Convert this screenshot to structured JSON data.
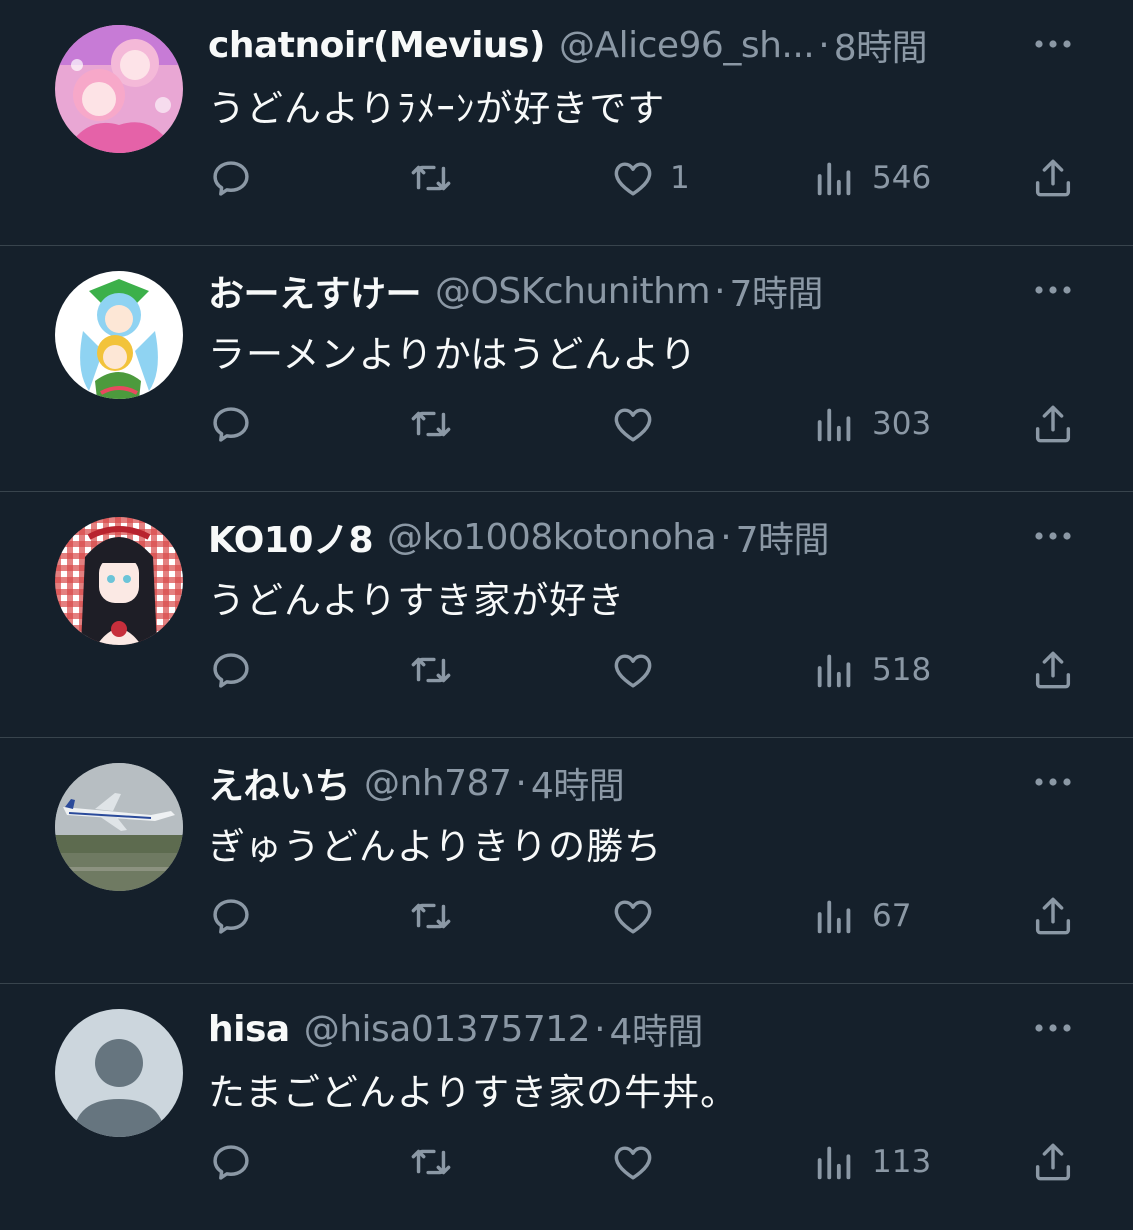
{
  "icons": {
    "reply": "reply-icon",
    "retweet": "retweet-icon",
    "like": "heart-icon",
    "views": "views-icon",
    "share": "share-icon",
    "more": "more-icon"
  },
  "colors": {
    "background": "#15202b",
    "divider": "#38444d",
    "primary_text": "#f7f9f9",
    "secondary_text": "#8b98a5"
  },
  "tweets": [
    {
      "name": "chatnoir(Mevius)",
      "handle": "@Alice96_sh...",
      "separator": "·",
      "time": "8時間",
      "text": "うどんよりﾗﾒｰﾝが好きです",
      "replies": "",
      "retweets": "",
      "likes": "1",
      "views": "546",
      "avatar": "pink-anime-avatar"
    },
    {
      "name": "おーえすけー",
      "handle": "@OSKchunithm",
      "separator": "·",
      "time": "7時間",
      "text": "ラーメンよりかはうどんより",
      "replies": "",
      "retweets": "",
      "likes": "",
      "views": "303",
      "avatar": "chibi-characters-avatar"
    },
    {
      "name": "KO10ノ8",
      "handle": "@ko1008kotonoha",
      "separator": "·",
      "time": "7時間",
      "text": "うどんよりすき家が好き",
      "replies": "",
      "retweets": "",
      "likes": "",
      "views": "518",
      "avatar": "dark-hair-girl-avatar"
    },
    {
      "name": "えねいち",
      "handle": "@nh787",
      "separator": "·",
      "time": "4時間",
      "text": "ぎゅうどんよりきりの勝ち",
      "replies": "",
      "retweets": "",
      "likes": "",
      "views": "67",
      "avatar": "airplane-avatar"
    },
    {
      "name": "hisa",
      "handle": "@hisa01375712",
      "separator": "·",
      "time": "4時間",
      "text": "たまごどんよりすき家の牛丼。",
      "replies": "",
      "retweets": "",
      "likes": "",
      "views": "113",
      "avatar": "default-avatar"
    }
  ]
}
